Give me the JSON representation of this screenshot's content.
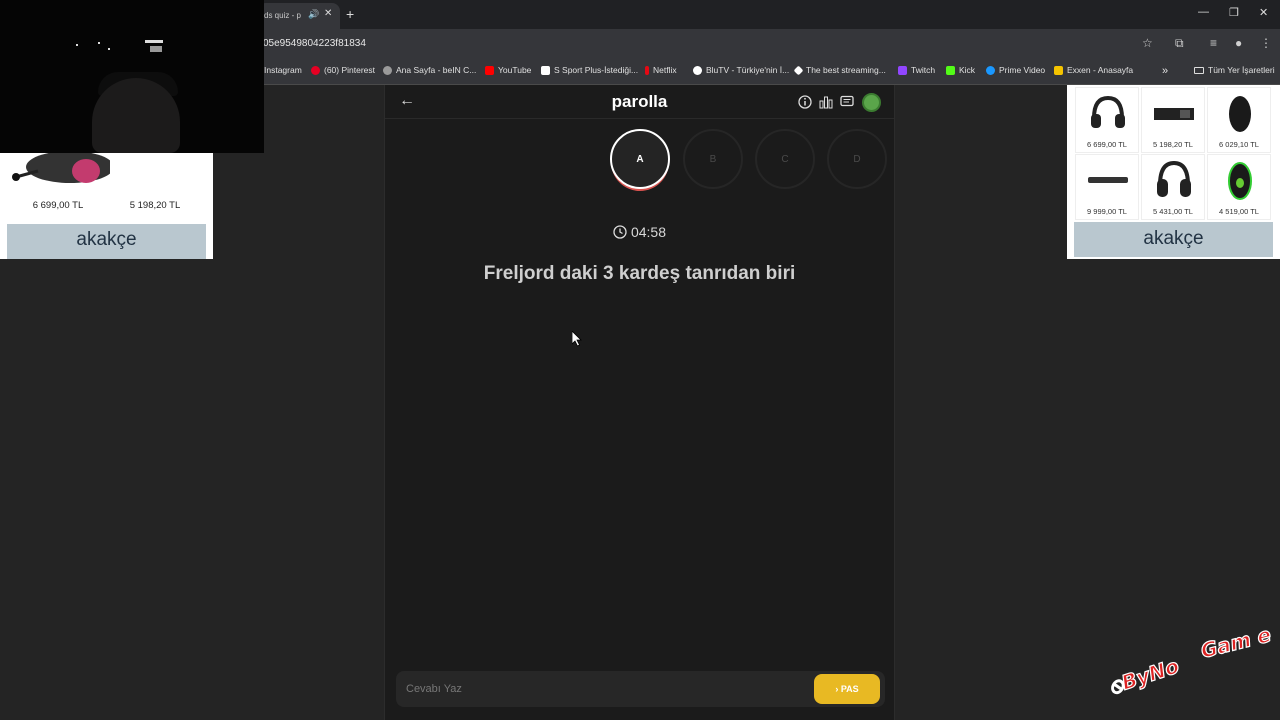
{
  "browser": {
    "tab_title": "ds quiz - p",
    "url": "05e9549804223f81834",
    "bookmarks": [
      {
        "label": "Instagram",
        "color": "#35363a"
      },
      {
        "label": "(60) Pinterest",
        "color": "#e60023"
      },
      {
        "label": "Ana Sayfa - beIN C...",
        "color": "#9a9a9a"
      },
      {
        "label": "YouTube",
        "color": "#ff0000"
      },
      {
        "label": "S Sport Plus-İstediği...",
        "color": "#ffffff"
      },
      {
        "label": "Netflix",
        "color": "#e50914"
      },
      {
        "label": "BluTV - Türkiye'nin İ...",
        "color": "#ffffff"
      },
      {
        "label": "The best streaming...",
        "color": "#ffffff"
      },
      {
        "label": "Twitch",
        "color": "#9146ff"
      },
      {
        "label": "Kick",
        "color": "#53fc18"
      },
      {
        "label": "Prime Video",
        "color": "#1a98ff"
      },
      {
        "label": "Exxen - Anasayfa",
        "color": "#f5c400"
      }
    ],
    "all_bookmarks_label": "Tüm Yer İşaretleri"
  },
  "left_ad": {
    "prices": [
      "6 699,00 TL",
      "5 198,20 TL"
    ],
    "brand": "akakçe"
  },
  "right_ad": {
    "prices": [
      "6 699,00 TL",
      "5 198,20 TL",
      "6 029,10 TL",
      "9 999,00 TL",
      "5 431,00 TL",
      "4 519,00 TL"
    ],
    "brand": "akakçe"
  },
  "game": {
    "brand": "parolla",
    "letters": [
      "A",
      "B",
      "C",
      "D"
    ],
    "active_letter": "A",
    "timer": "04:58",
    "question": "Freljord daki 3 kardeş tanrıdan biri",
    "answer_placeholder": "Cevabı Yaz",
    "pas_label": "PAS",
    "accent_color": "#e8b923"
  }
}
